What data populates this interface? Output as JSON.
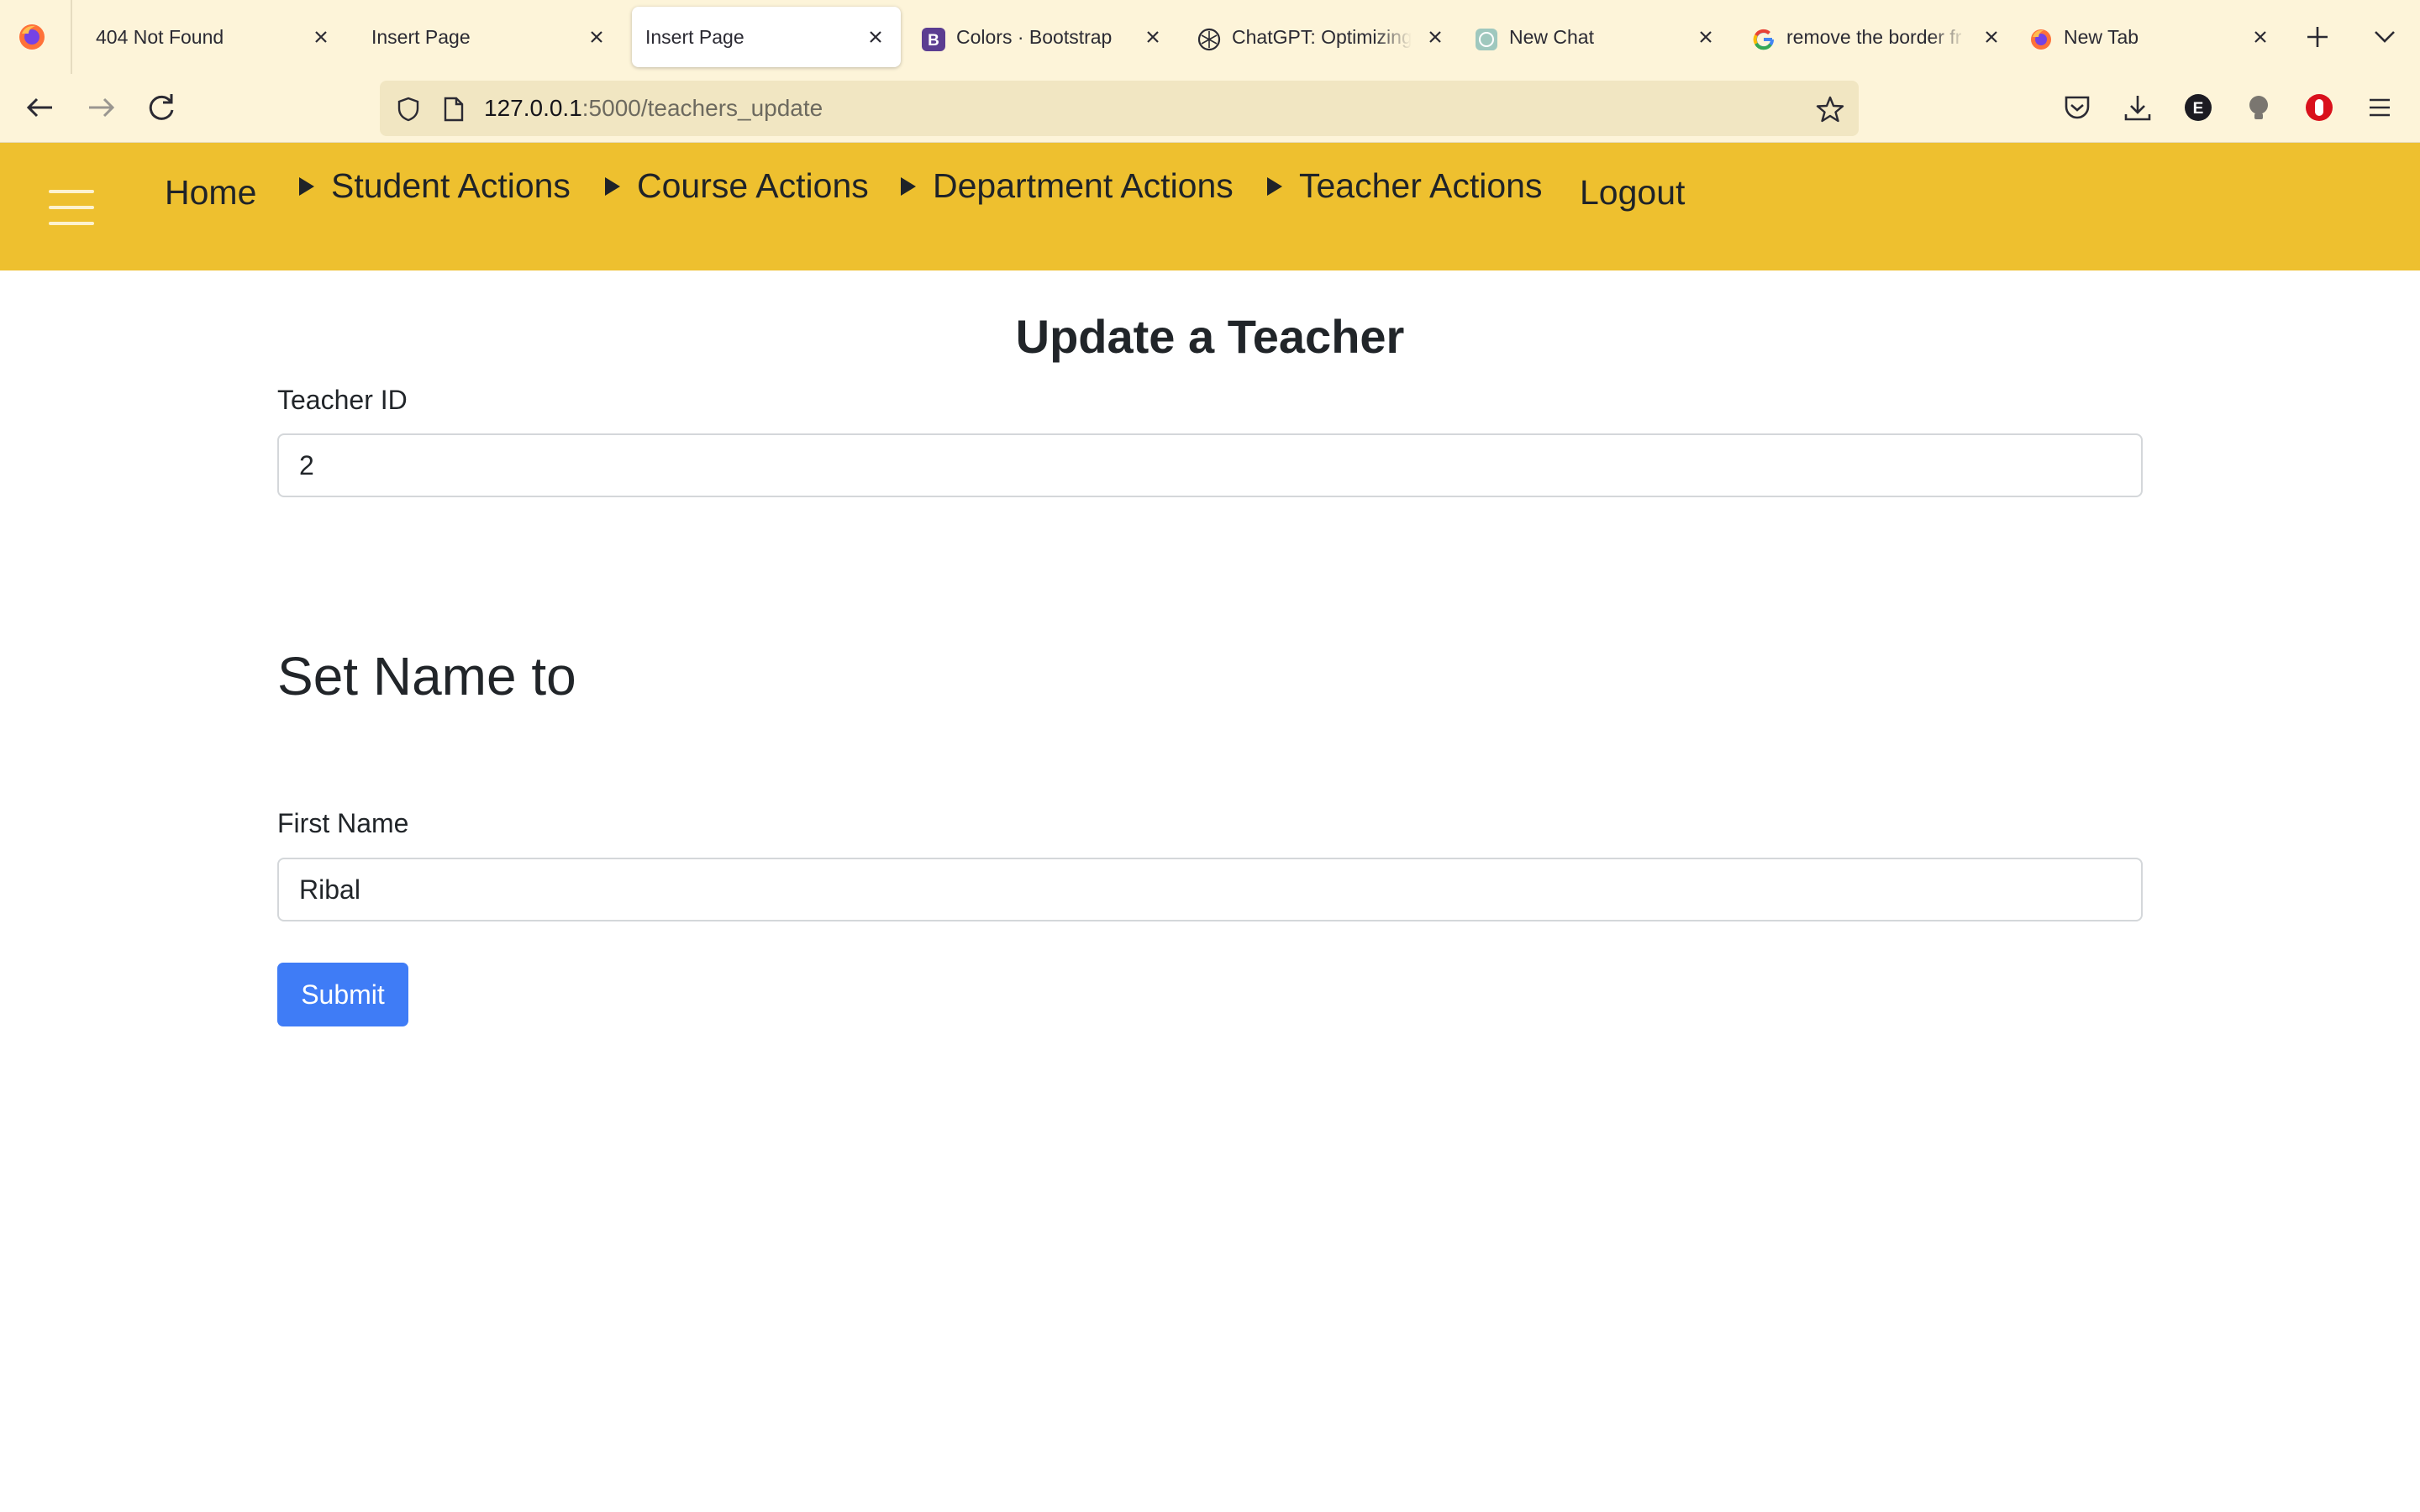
{
  "browser": {
    "tabs": [
      {
        "title": "404 Not Found",
        "favicon": "none",
        "active": false
      },
      {
        "title": "Insert Page",
        "favicon": "none",
        "active": false
      },
      {
        "title": "Insert Page",
        "favicon": "none",
        "active": true
      },
      {
        "title": "Colors · Bootstrap",
        "favicon": "bootstrap-icon",
        "active": false
      },
      {
        "title": "ChatGPT: Optimizing",
        "favicon": "openai-icon",
        "active": false
      },
      {
        "title": "New Chat",
        "favicon": "chat-icon",
        "active": false
      },
      {
        "title": "remove the border fr",
        "favicon": "google-icon",
        "active": false
      },
      {
        "title": "New Tab",
        "favicon": "firefox-icon",
        "active": false
      }
    ],
    "url_host": "127.0.0.1",
    "url_rest": ":5000/teachers_update",
    "extension_badge": "E"
  },
  "nav": {
    "home": "Home",
    "student_actions": "Student Actions",
    "course_actions": "Course Actions",
    "department_actions": "Department Actions",
    "teacher_actions": "Teacher Actions",
    "logout": "Logout"
  },
  "page": {
    "title": "Update a Teacher",
    "teacher_id_label": "Teacher ID",
    "teacher_id_value": "2",
    "section_heading": "Set Name to",
    "first_name_label": "First Name",
    "first_name_value": "Ribal",
    "submit_label": "Submit"
  },
  "colors": {
    "navbar_bg": "#eec02f",
    "submit_bg": "#3f7cf6",
    "chrome_bg": "#fdf4d9",
    "urlbar_bg": "#f1e6c2"
  }
}
